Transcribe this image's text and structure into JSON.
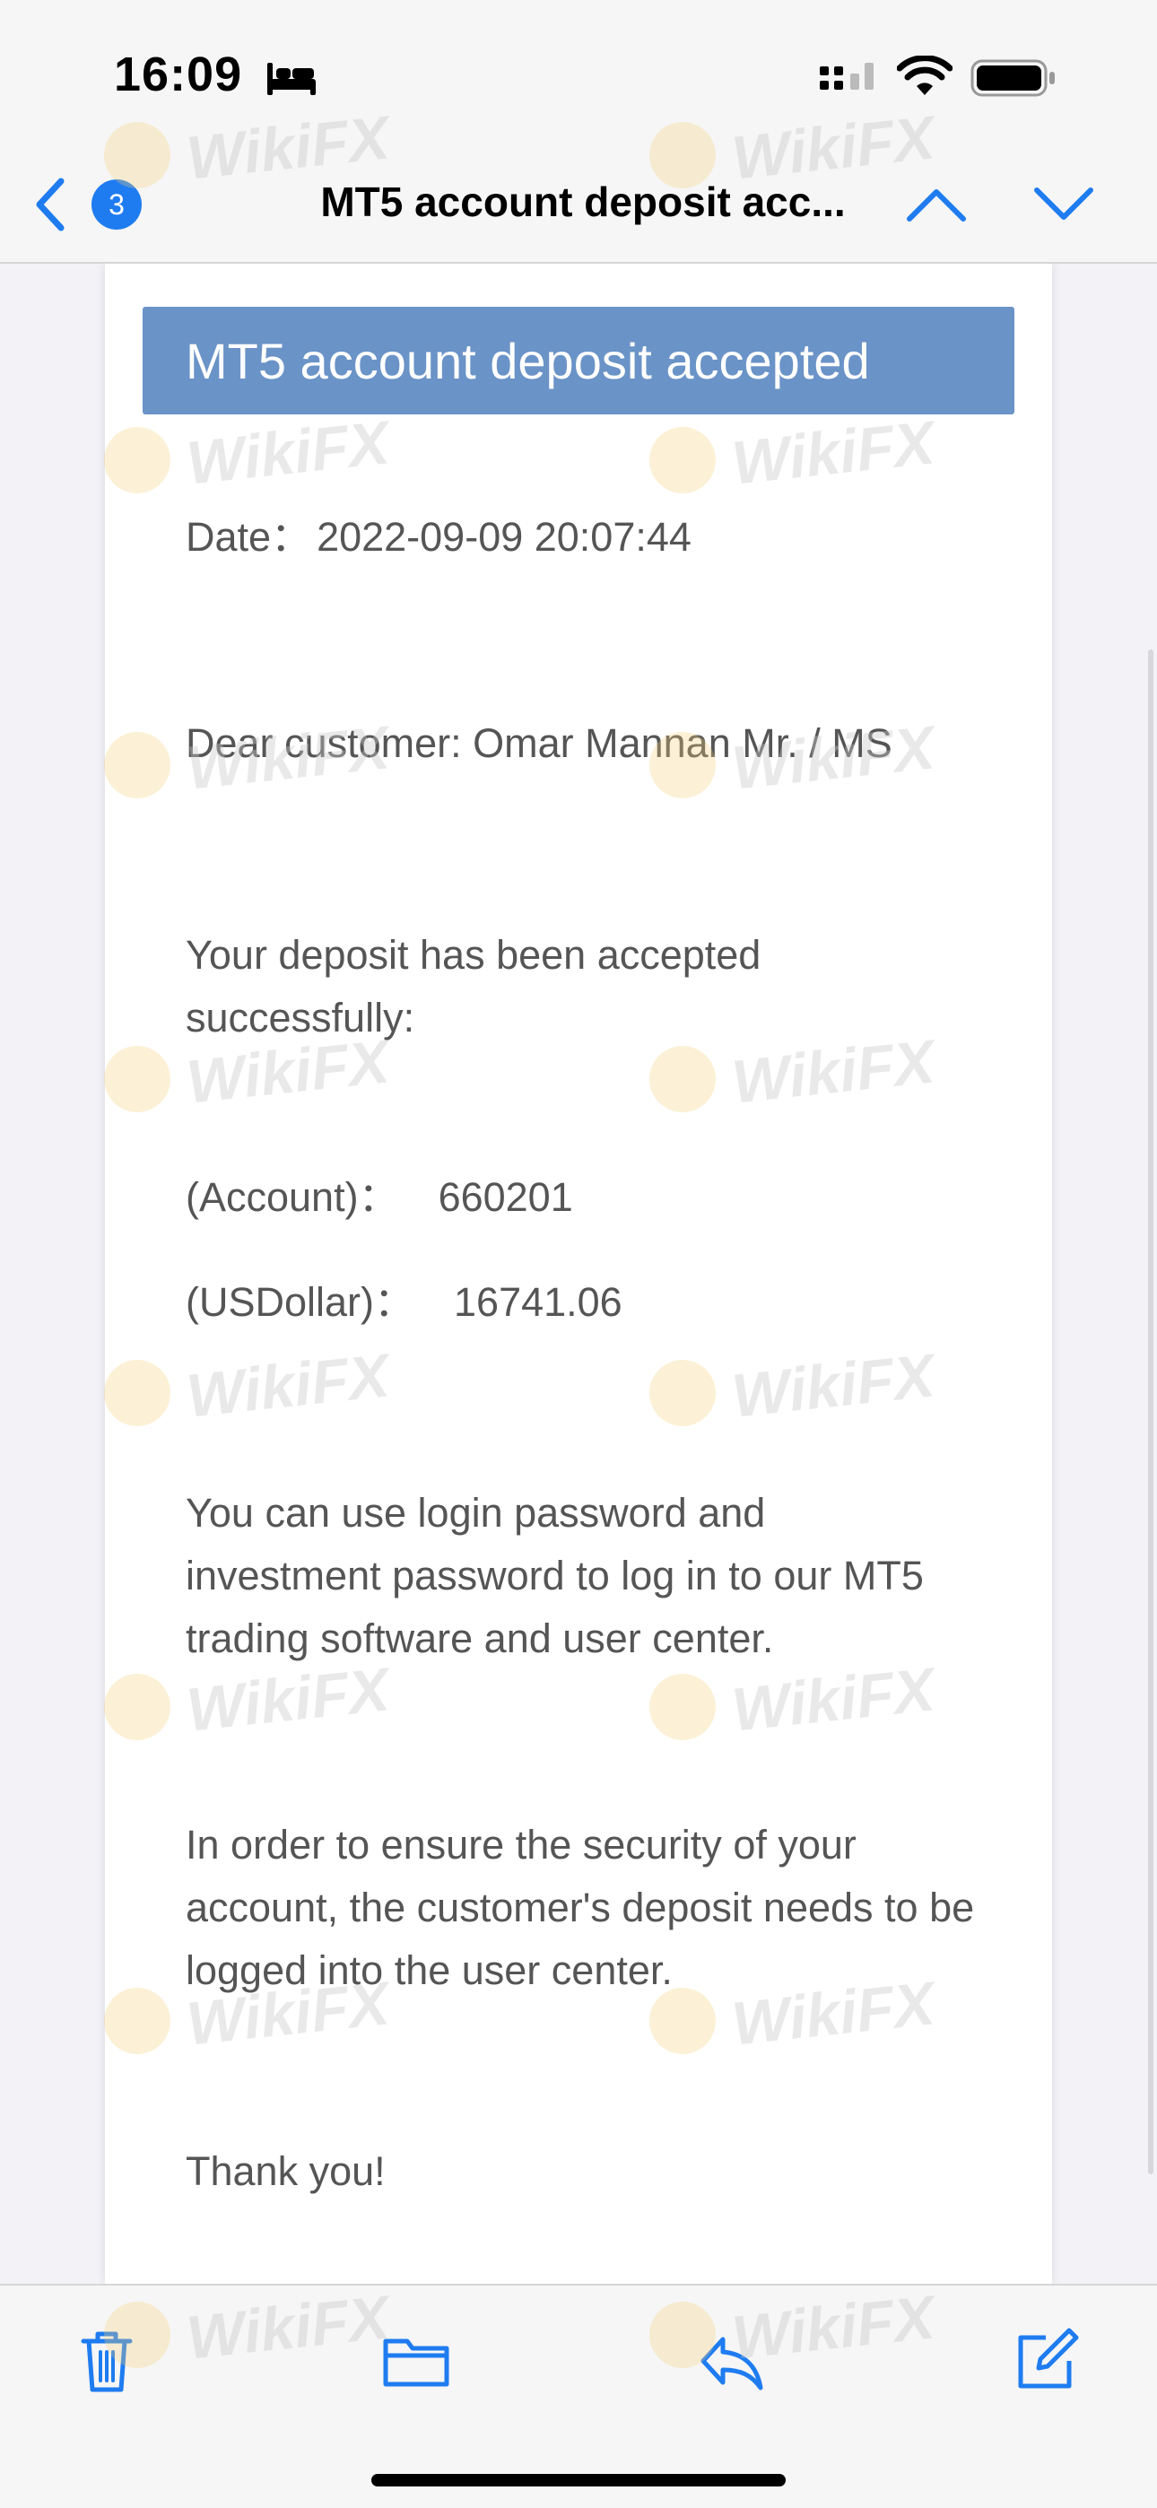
{
  "status_bar": {
    "time": "16:09",
    "icons": [
      "bed-icon",
      "cellular-signal-icon",
      "wifi-icon",
      "battery-icon"
    ]
  },
  "nav": {
    "unread_count": "3",
    "title": "MT5 account deposit acc...",
    "icons": [
      "back-chevron-icon",
      "previous-message-icon",
      "next-message-icon"
    ]
  },
  "email": {
    "banner_title": "MT5 account deposit accepted",
    "date_label": "Date：",
    "date_value": "2022-09-09 20:07:44",
    "greeting": "Dear customer: Omar Mannan Mr. / MS",
    "deposit_message": "Your deposit has been accepted successfully:",
    "account_label": "(Account)：",
    "account_value": "660201",
    "amount_label": "(USDollar)：",
    "amount_value": "16741.06",
    "login_info": "You can use login password and investment password to log in to our MT5 trading software and user center.",
    "security_note": "In order to ensure the security of your account, the customer's deposit needs to be logged into the user center.",
    "closing": "Thank you!"
  },
  "toolbar": {
    "icons": [
      "trash-icon",
      "folder-icon",
      "reply-icon",
      "compose-icon"
    ]
  },
  "watermark": {
    "text": "WikiFX"
  },
  "colors": {
    "accent": "#1f7cf0",
    "banner": "#6a93c7",
    "body_text": "#555555",
    "background": "#f2f2f7"
  }
}
